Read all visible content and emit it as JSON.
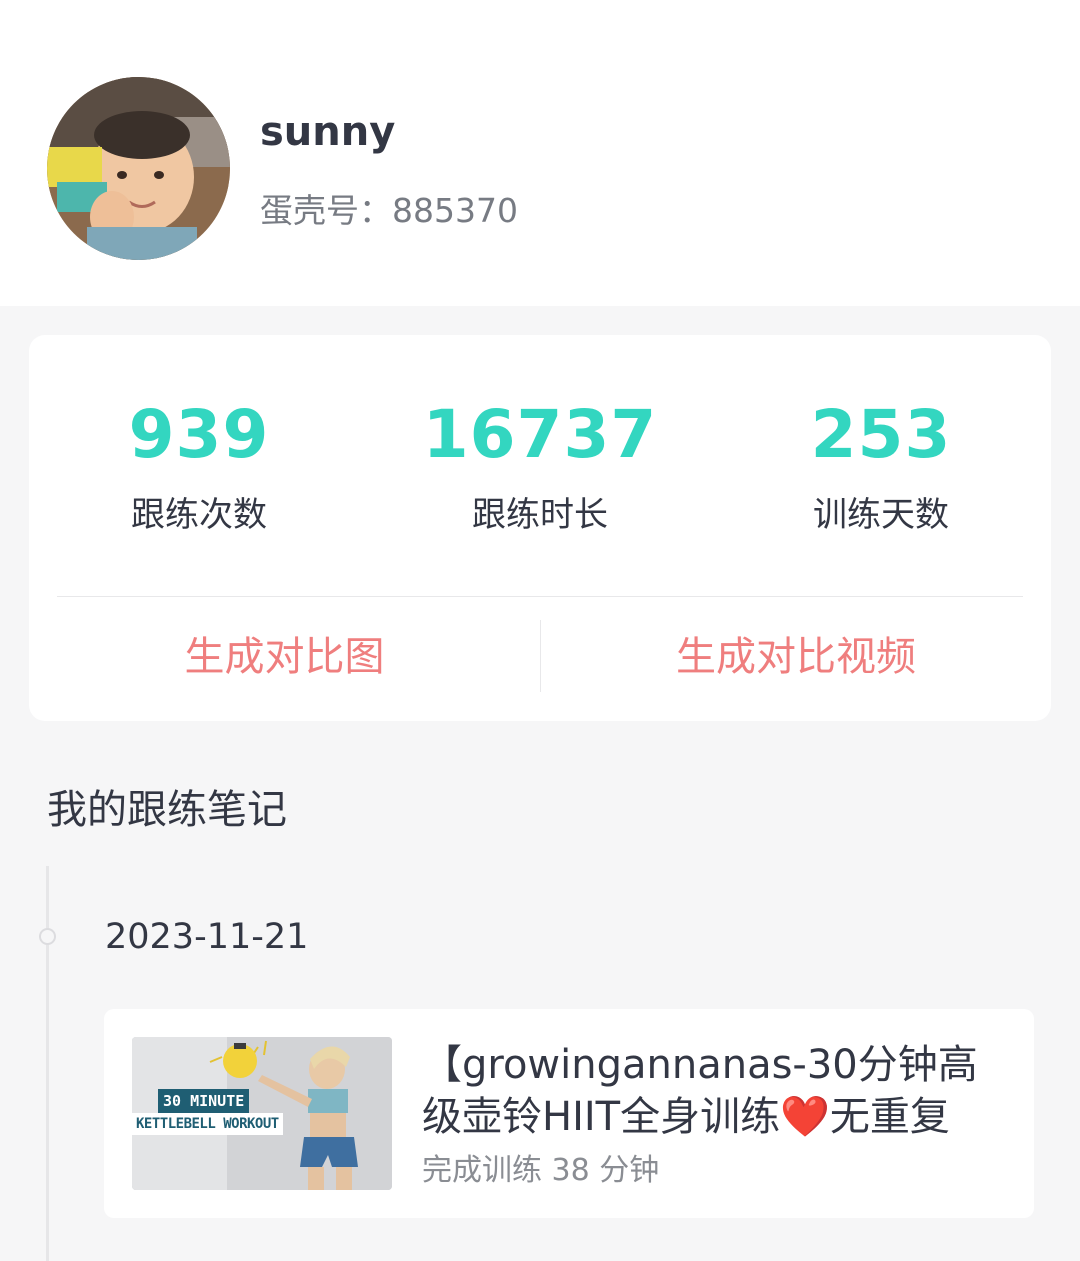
{
  "profile": {
    "username": "sunny",
    "id_text": "蛋壳号：885370"
  },
  "stats": [
    {
      "value": "939",
      "label": "跟练次数"
    },
    {
      "value": "16737",
      "label": "跟练时长"
    },
    {
      "value": "253",
      "label": "训练天数"
    }
  ],
  "actions": {
    "compare_image": "生成对比图",
    "compare_video": "生成对比视频"
  },
  "notes": {
    "section_title": "我的跟练笔记",
    "entries": [
      {
        "date": "2023-11-21",
        "title": "【growingannanas-30分钟高级壶铃HIIT全身训练❤️无重复",
        "subtitle": "完成训练 38 分钟",
        "thumbnail": {
          "line1": "30 MINUTE",
          "line2": "KETTLEBELL WORKOUT"
        }
      }
    ]
  },
  "colors": {
    "accent_teal": "#33d6c0",
    "accent_red": "#ef7e7e",
    "background": "#f6f6f7"
  }
}
